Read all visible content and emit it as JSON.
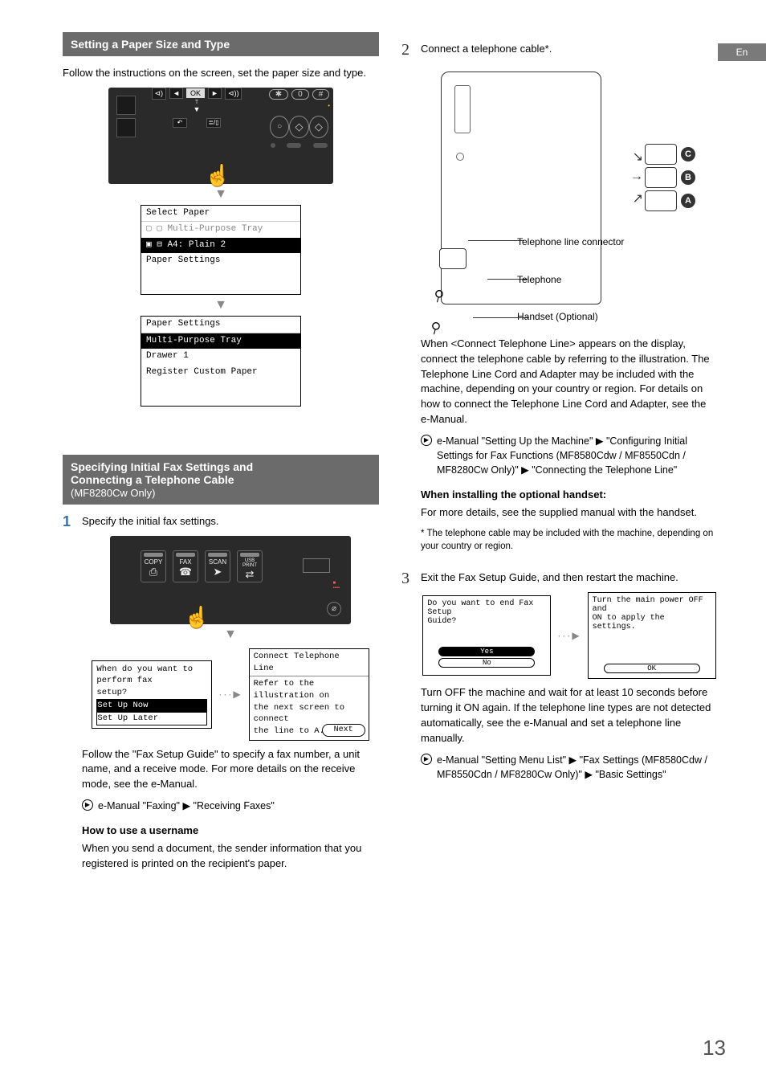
{
  "lang_tab": "En",
  "page_number": "13",
  "left": {
    "section1_title": "Setting a Paper Size and Type",
    "section1_intro": "Follow the instructions on the screen, set the paper size and type.",
    "panel": {
      "nav_keys": [
        "◄",
        "OK",
        "►"
      ],
      "nav_sides": [
        "⊲)",
        "⊲))"
      ],
      "below_t": "T",
      "back_icon": "↶",
      "doc_icon": "≣/▯",
      "right_row": [
        "✱",
        "0",
        "#"
      ],
      "yellow_dot_row": "•",
      "run_stop": "◇"
    },
    "lcd1": {
      "title": "Select Paper",
      "rows": [
        "▢ ▢ Multi-Purpose Tray",
        "▣ ⊟ A4: Plain 2",
        "Paper Settings"
      ]
    },
    "lcd2": {
      "title": "Paper Settings",
      "rows": [
        "Multi-Purpose Tray",
        "Drawer 1",
        "Register Custom Paper"
      ]
    },
    "section2_title_l1": "Specifying Initial Fax Settings and",
    "section2_title_l2": "Connecting a Telephone Cable",
    "section2_sub": "(MF8280Cw Only)",
    "step1_num": "1",
    "step1_text": "Specify the initial fax settings.",
    "cp_buttons": [
      "COPY",
      "FAX",
      "SCAN",
      "USB PRINT"
    ],
    "cp_icons": [
      "⎙",
      "☎",
      "➤",
      "⇄"
    ],
    "fax_lcd_a": {
      "l1": "When do you want to perform fax",
      "l2": "setup?",
      "opt1": "Set Up Now",
      "opt2": "Set Up Later"
    },
    "fax_lcd_b": {
      "title": "Connect Telephone Line",
      "l1": "Refer to the illustration on",
      "l2": "the next screen to connect",
      "l3": "the line to A.",
      "btn": "Next"
    },
    "step1_para": "Follow the \"Fax Setup Guide\" to specify a fax number, a unit name, and a receive mode. For more details on the receive mode, see the e-Manual.",
    "step1_ref": "e-Manual \"Faxing\" ▶ \"Receiving Faxes\"",
    "username_h": "How to use a username",
    "username_p": "When you send a document, the sender information that you registered is printed on the recipient's paper."
  },
  "right": {
    "step2_num": "2",
    "step2_text": "Connect a telephone cable*.",
    "diag_labels": {
      "line": "Telephone line connector",
      "phone": "Telephone",
      "handset": "Handset (Optional)",
      "ports": [
        "C",
        "B",
        "A"
      ]
    },
    "step2_para": "When <Connect Telephone Line> appears on the display, connect the telephone cable by referring to the illustration. The Telephone Line Cord and Adapter may be included with the machine, depending on your country or region. For details on how to connect the Telephone Line Cord and Adapter, see the e-Manual.",
    "step2_ref": "e-Manual \"Setting Up the Machine\" ▶ \"Configuring Initial Settings for Fax Functions (MF8580Cdw / MF8550Cdn / MF8280Cw Only)\" ▶ \"Connecting the Telephone Line\"",
    "handset_h": "When installing the optional handset:",
    "handset_p": "For more details, see the supplied manual with the handset.",
    "footnote": "* The telephone cable may be included with the machine, depending on your country or region.",
    "step3_num": "3",
    "step3_text": "Exit the Fax Setup Guide, and then restart the machine.",
    "lcd3a": {
      "l1": "Do you want to end Fax Setup",
      "l2": "Guide?",
      "yes": "Yes",
      "no": "No"
    },
    "lcd3b": {
      "l1": "Turn the main power OFF and",
      "l2": "ON to apply the settings.",
      "ok": "OK"
    },
    "step3_para": "Turn OFF the machine and wait for at least 10 seconds before turning it ON again. If the telephone line types are not detected automatically, see the e-Manual and set a telephone line manually.",
    "step3_ref": "e-Manual \"Setting Menu List\" ▶ \"Fax Settings (MF8580Cdw / MF8550Cdn / MF8280Cw Only)\" ▶ \"Basic Settings\""
  }
}
